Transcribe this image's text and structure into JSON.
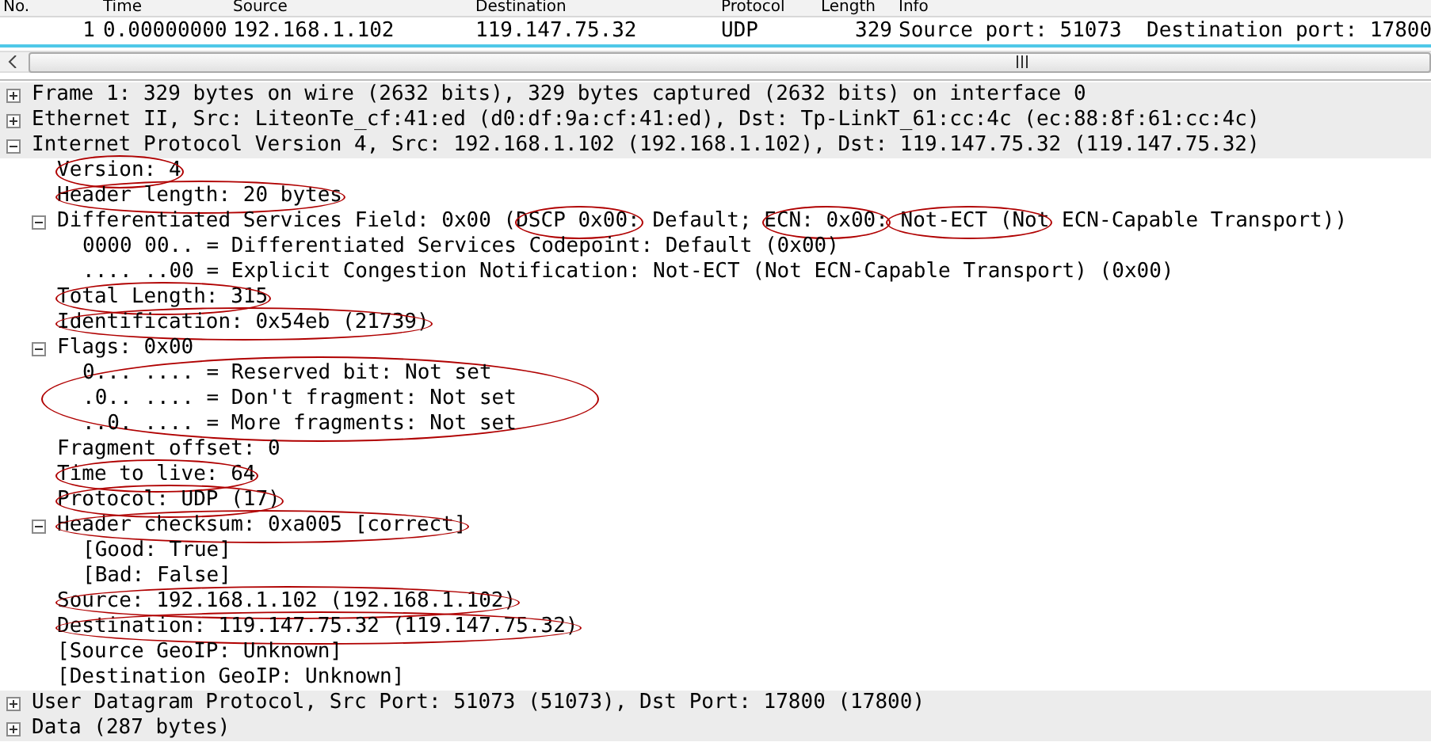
{
  "packet_list": {
    "columns": [
      "No.",
      "Time",
      "Source",
      "Destination",
      "Protocol",
      "Length",
      "Info"
    ],
    "rows": [
      {
        "selected": false,
        "cells": [
          "1",
          "0.00000000",
          "192.168.1.102",
          "119.147.75.32",
          "UDP",
          "329",
          "Source port: 51073  Destination port: 17800"
        ]
      }
    ]
  },
  "details": [
    {
      "text": "Frame 1: 329 bytes on wire (2632 bits), 329 bytes captured (2632 bits) on interface 0",
      "expanded": false
    },
    {
      "text": "Ethernet II, Src: LiteonTe_cf:41:ed (d0:df:9a:cf:41:ed), Dst: Tp-LinkT_61:cc:4c (ec:88:8f:61:cc:4c)",
      "expanded": false
    },
    {
      "text": "Internet Protocol Version 4, Src: 192.168.1.102 (192.168.1.102), Dst: 119.147.75.32 (119.147.75.32)",
      "expanded": true,
      "children": [
        {
          "text": "Version: 4",
          "circled": true
        },
        {
          "text": "Header length: 20 bytes",
          "circled": true
        },
        {
          "parts": [
            {
              "text": "Differentiated Services Field: 0x00 (",
              "circled": false
            },
            {
              "text": "DSCP 0x00:",
              "circled": true
            },
            {
              "text": " Default; ",
              "circled": false
            },
            {
              "text": "ECN: 0x00:",
              "circled": true
            },
            {
              "text": " Not-ECT (Not",
              "circled": true
            },
            {
              "text": " ECN-Capable Transport))",
              "circled": false
            }
          ],
          "expanded": true,
          "children": [
            {
              "text": "0000 00.. = Differentiated Services Codepoint: Default (0x00)"
            },
            {
              "text": ".... ..00 = Explicit Congestion Notification: Not-ECT (Not ECN-Capable Transport) (0x00)"
            }
          ]
        },
        {
          "text": "Total Length: 315",
          "circled": true
        },
        {
          "text": "Identification: 0x54eb (21739)",
          "circled": true
        },
        {
          "text": "Flags: 0x00",
          "expanded": true,
          "children_circled": true,
          "children": [
            {
              "text": "0... .... = Reserved bit: Not set"
            },
            {
              "text": ".0.. .... = Don't fragment: Not set"
            },
            {
              "text": "..0. .... = More fragments: Not set"
            }
          ]
        },
        {
          "text": "Fragment offset: 0"
        },
        {
          "text": "Time to live: 64",
          "circled": true
        },
        {
          "text": "Protocol: UDP (17)",
          "circled": true
        },
        {
          "text": "Header checksum: 0xa005 [correct]",
          "circled": true,
          "expanded": true,
          "children": [
            {
              "text": "[Good: True]"
            },
            {
              "text": "[Bad: False]"
            }
          ]
        },
        {
          "text": "Source: 192.168.1.102 (192.168.1.102)",
          "circled": true
        },
        {
          "text": "Destination: 119.147.75.32 (119.147.75.32)",
          "circled": true
        },
        {
          "text": "[Source GeoIP: Unknown]"
        },
        {
          "text": "[Destination GeoIP: Unknown]"
        }
      ]
    },
    {
      "text": "User Datagram Protocol, Src Port: 51073 (51073), Dst Port: 17800 (17800)",
      "expanded": false
    },
    {
      "text": "Data (287 bytes)",
      "expanded": false
    }
  ]
}
